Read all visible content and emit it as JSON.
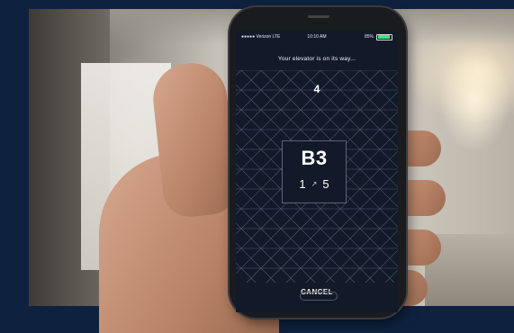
{
  "status_bar": {
    "carrier": "●●●●● Verizon  LTE",
    "time": "10:10 AM",
    "battery": "85%"
  },
  "elevator": {
    "message": "Your elevator is on its way...",
    "current_floor": "4",
    "destination": "B3",
    "from": "1",
    "to": "5",
    "cancel_label": "CANCEL"
  },
  "colors": {
    "frame_background": "#0e2240",
    "screen_background": "#121a2a",
    "pattern_line": "#4e5a70"
  }
}
